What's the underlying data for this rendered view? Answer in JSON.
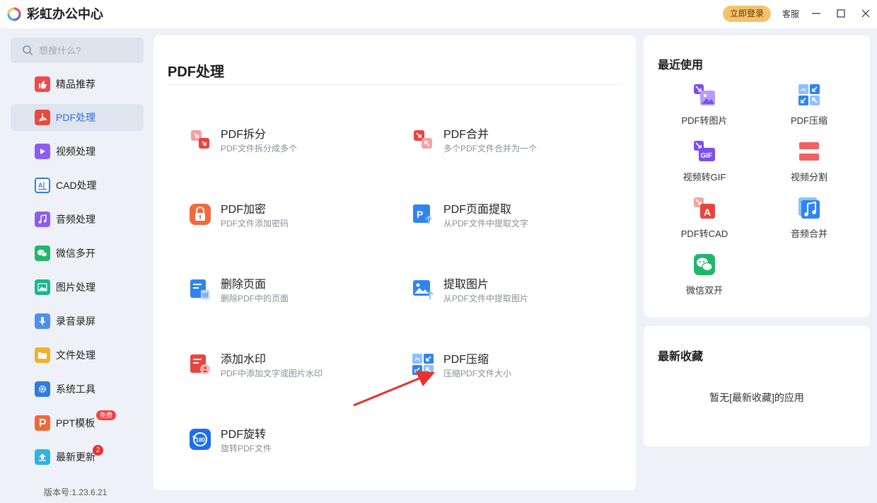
{
  "app": {
    "title": "彩虹办公中心",
    "login": "立即登录",
    "service": "客服"
  },
  "search": {
    "placeholder": "想搜什么?"
  },
  "sidebar": {
    "items": [
      {
        "label": "精品推荐",
        "icon": "thumbs-up-icon",
        "color": "#ea4c4c"
      },
      {
        "label": "PDF处理",
        "icon": "pdf-icon",
        "color": "#e84a3f"
      },
      {
        "label": "视频处理",
        "icon": "play-icon",
        "color": "#8e5cf0"
      },
      {
        "label": "CAD处理",
        "icon": "cad-icon",
        "color": "#2f7de1"
      },
      {
        "label": "音频处理",
        "icon": "music-icon",
        "color": "#8e5cf0"
      },
      {
        "label": "微信多开",
        "icon": "wechat-icon",
        "color": "#22b66b"
      },
      {
        "label": "图片处理",
        "icon": "image-icon",
        "color": "#1bb58f"
      },
      {
        "label": "录音录屏",
        "icon": "microphone-icon",
        "color": "#4c8ff0"
      },
      {
        "label": "文件处理",
        "icon": "folder-icon",
        "color": "#f5b02a"
      },
      {
        "label": "系统工具",
        "icon": "gear-icon",
        "color": "#2f7de1"
      },
      {
        "label": "PPT模板",
        "icon": "ppt-icon",
        "color": "#ee6a3b"
      },
      {
        "label": "最新更新",
        "icon": "upload-icon",
        "color": "#2db3e6"
      }
    ],
    "free_badge": "免费",
    "update_count": "2",
    "version": "版本号:1.23.6.21"
  },
  "main": {
    "title": "PDF处理",
    "tools": [
      {
        "name": "PDF拆分",
        "desc": "PDF文件拆分成多个"
      },
      {
        "name": "PDF合并",
        "desc": "多个PDF文件合并为一个"
      },
      {
        "name": "PDF加密",
        "desc": "PDF文件添加密码"
      },
      {
        "name": "PDF页面提取",
        "desc": "从PDF文件中提取文字"
      },
      {
        "name": "删除页面",
        "desc": "删除PDF中的页面"
      },
      {
        "name": "提取图片",
        "desc": "从PDF文件中提取图片"
      },
      {
        "name": "添加水印",
        "desc": "PDF中添加文字或图片水印"
      },
      {
        "name": "PDF压缩",
        "desc": "压缩PDF文件大小"
      },
      {
        "name": "PDF旋转",
        "desc": "旋转PDF文件"
      }
    ]
  },
  "recent": {
    "title": "最近使用",
    "items": [
      {
        "label": "PDF转图片"
      },
      {
        "label": "PDF压缩"
      },
      {
        "label": "视频转GIF"
      },
      {
        "label": "视频分割"
      },
      {
        "label": "PDF转CAD"
      },
      {
        "label": "音频合并"
      },
      {
        "label": "微信双开"
      }
    ]
  },
  "favorites": {
    "title": "最新收藏",
    "empty": "暂无[最新收藏]的应用"
  },
  "colors": {
    "accent": "#2f6fe0",
    "login_bg": "#f5c26b",
    "arrow": "#e8322f"
  }
}
